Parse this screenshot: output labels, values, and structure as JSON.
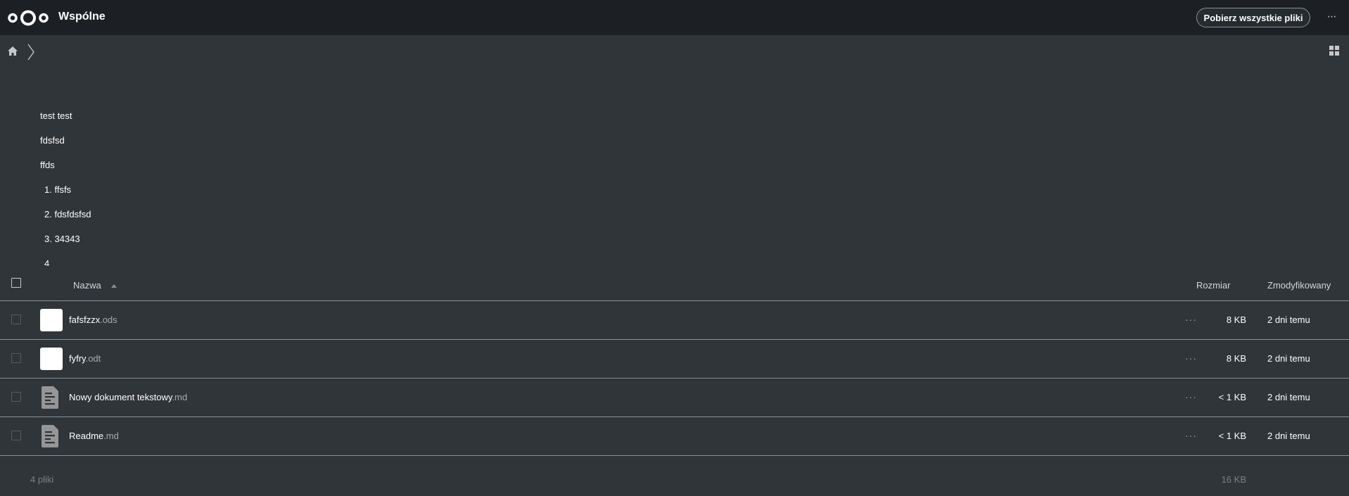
{
  "app": {
    "title": "Wspólne"
  },
  "header": {
    "download_label": "Pobierz wszystkie pliki",
    "more_label": "···"
  },
  "readme": {
    "paragraphs": [
      "test test",
      "fdsfsd",
      "ffds"
    ],
    "list": [
      "1. ffsfs",
      "2. fdsfdsfsd",
      "3. 34343",
      "4"
    ]
  },
  "columns": {
    "name": "Nazwa",
    "size": "Rozmiar",
    "modified": "Zmodyfikowany"
  },
  "files": [
    {
      "base": "fafsfzzx",
      "ext": ".ods",
      "size": "8 KB",
      "modified": "2 dni temu",
      "icon": "spreadsheet-thumbnail"
    },
    {
      "base": "fyfry",
      "ext": ".odt",
      "size": "8 KB",
      "modified": "2 dni temu",
      "icon": "document-thumbnail"
    },
    {
      "base": "Nowy dokument tekstowy",
      "ext": ".md",
      "size": "< 1 KB",
      "modified": "2 dni temu",
      "icon": "text-file-icon"
    },
    {
      "base": "Readme",
      "ext": ".md",
      "size": "< 1 KB",
      "modified": "2 dni temu",
      "icon": "text-file-icon"
    }
  ],
  "actions_label": "···",
  "summary": {
    "count": "4 pliki",
    "total_size": "16 KB"
  },
  "colors": {
    "header_bg": "#1c2024",
    "page_bg": "#30353a",
    "text": "#ffffff"
  }
}
